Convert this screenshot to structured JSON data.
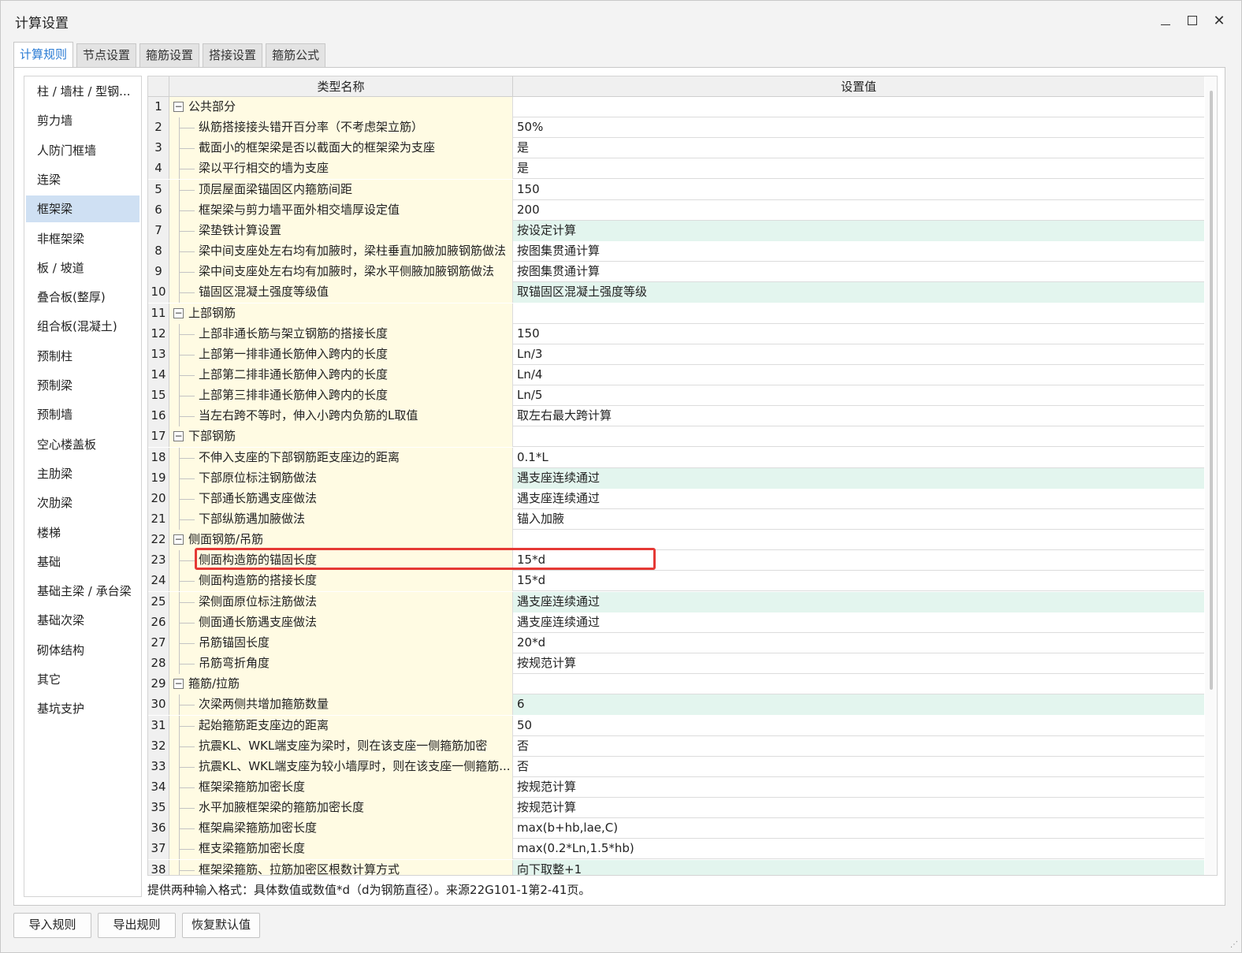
{
  "window": {
    "title": "计算设置",
    "minimize_glyph": "—",
    "maximize_glyph": "☐",
    "close_glyph": "✕"
  },
  "tabs": [
    {
      "label": "计算规则",
      "active": true
    },
    {
      "label": "节点设置",
      "active": false
    },
    {
      "label": "箍筋设置",
      "active": false
    },
    {
      "label": "搭接设置",
      "active": false
    },
    {
      "label": "箍筋公式",
      "active": false
    }
  ],
  "sidebar": {
    "selected_index": 4,
    "items": [
      "柱 / 墙柱 / 型钢...",
      "剪力墙",
      "人防门框墙",
      "连梁",
      "框架梁",
      "非框架梁",
      "板 / 坡道",
      "叠合板(整厚)",
      "组合板(混凝土)",
      "预制柱",
      "预制梁",
      "预制墙",
      "空心楼盖板",
      "主肋梁",
      "次肋梁",
      "楼梯",
      "基础",
      "基础主梁 / 承台梁",
      "基础次梁",
      "砌体结构",
      "其它",
      "基坑支护"
    ]
  },
  "grid": {
    "columns": {
      "name": "类型名称",
      "value": "设置值"
    },
    "highlight_color": "#e3f5ee",
    "rows": [
      {
        "no": "1",
        "name": "公共部分",
        "value": "",
        "group": true
      },
      {
        "no": "2",
        "name": "纵筋搭接接头错开百分率（不考虑架立筋）",
        "value": "50%"
      },
      {
        "no": "3",
        "name": "截面小的框架梁是否以截面大的框架梁为支座",
        "value": "是"
      },
      {
        "no": "4",
        "name": "梁以平行相交的墙为支座",
        "value": "是"
      },
      {
        "no": "5",
        "name": "顶层屋面梁锚固区内箍筋间距",
        "value": "150"
      },
      {
        "no": "6",
        "name": "框架梁与剪力墙平面外相交墙厚设定值",
        "value": "200"
      },
      {
        "no": "7",
        "name": "梁垫铁计算设置",
        "value": "按设定计算",
        "hl": true
      },
      {
        "no": "8",
        "name": "梁中间支座处左右均有加腋时，梁柱垂直加腋加腋钢筋做法",
        "value": "按图集贯通计算"
      },
      {
        "no": "9",
        "name": "梁中间支座处左右均有加腋时，梁水平侧腋加腋钢筋做法",
        "value": "按图集贯通计算"
      },
      {
        "no": "10",
        "name": "锚固区混凝土强度等级值",
        "value": "取锚固区混凝土强度等级",
        "hl": true
      },
      {
        "no": "11",
        "name": "上部钢筋",
        "value": "",
        "group": true
      },
      {
        "no": "12",
        "name": "上部非通长筋与架立钢筋的搭接长度",
        "value": "150"
      },
      {
        "no": "13",
        "name": "上部第一排非通长筋伸入跨内的长度",
        "value": "Ln/3"
      },
      {
        "no": "14",
        "name": "上部第二排非通长筋伸入跨内的长度",
        "value": "Ln/4"
      },
      {
        "no": "15",
        "name": "上部第三排非通长筋伸入跨内的长度",
        "value": "Ln/5"
      },
      {
        "no": "16",
        "name": "当左右跨不等时，伸入小跨内负筋的L取值",
        "value": "取左右最大跨计算"
      },
      {
        "no": "17",
        "name": "下部钢筋",
        "value": "",
        "group": true
      },
      {
        "no": "18",
        "name": "不伸入支座的下部钢筋距支座边的距离",
        "value": "0.1*L"
      },
      {
        "no": "19",
        "name": "下部原位标注钢筋做法",
        "value": "遇支座连续通过",
        "hl": true
      },
      {
        "no": "20",
        "name": "下部通长筋遇支座做法",
        "value": "遇支座连续通过"
      },
      {
        "no": "21",
        "name": "下部纵筋遇加腋做法",
        "value": "锚入加腋"
      },
      {
        "no": "22",
        "name": "侧面钢筋/吊筋",
        "value": "",
        "group": true
      },
      {
        "no": "23",
        "name": "侧面构造筋的锚固长度",
        "value": "15*d"
      },
      {
        "no": "24",
        "name": "侧面构造筋的搭接长度",
        "value": "15*d"
      },
      {
        "no": "25",
        "name": "梁侧面原位标注筋做法",
        "value": "遇支座连续通过",
        "hl": true
      },
      {
        "no": "26",
        "name": "侧面通长筋遇支座做法",
        "value": "遇支座连续通过"
      },
      {
        "no": "27",
        "name": "吊筋锚固长度",
        "value": "20*d"
      },
      {
        "no": "28",
        "name": "吊筋弯折角度",
        "value": "按规范计算"
      },
      {
        "no": "29",
        "name": "箍筋/拉筋",
        "value": "",
        "group": true
      },
      {
        "no": "30",
        "name": "次梁两侧共增加箍筋数量",
        "value": "6",
        "hl": true
      },
      {
        "no": "31",
        "name": "起始箍筋距支座边的距离",
        "value": "50"
      },
      {
        "no": "32",
        "name": "抗震KL、WKL端支座为梁时，则在该支座一侧箍筋加密",
        "value": "否"
      },
      {
        "no": "33",
        "name": "抗震KL、WKL端支座为较小墙厚时，则在该支座一侧箍筋...",
        "value": "否"
      },
      {
        "no": "34",
        "name": "框架梁箍筋加密长度",
        "value": "按规范计算"
      },
      {
        "no": "35",
        "name": "水平加腋框架梁的箍筋加密长度",
        "value": "按规范计算"
      },
      {
        "no": "36",
        "name": "框架扁梁箍筋加密长度",
        "value": "max(b+hb,lae,C)"
      },
      {
        "no": "37",
        "name": "框支梁箍筋加密长度",
        "value": "max(0.2*Ln,1.5*hb)"
      },
      {
        "no": "38",
        "name": "框架梁箍筋、拉筋加密区根数计算方式",
        "value": "向下取整+1",
        "hl": true
      }
    ]
  },
  "hint": "提供两种输入格式：具体数值或数值*d（d为钢筋直径）。来源22G101-1第2-41页。",
  "buttons": {
    "import": "导入规则",
    "export": "导出规则",
    "restore": "恢复默认值"
  }
}
